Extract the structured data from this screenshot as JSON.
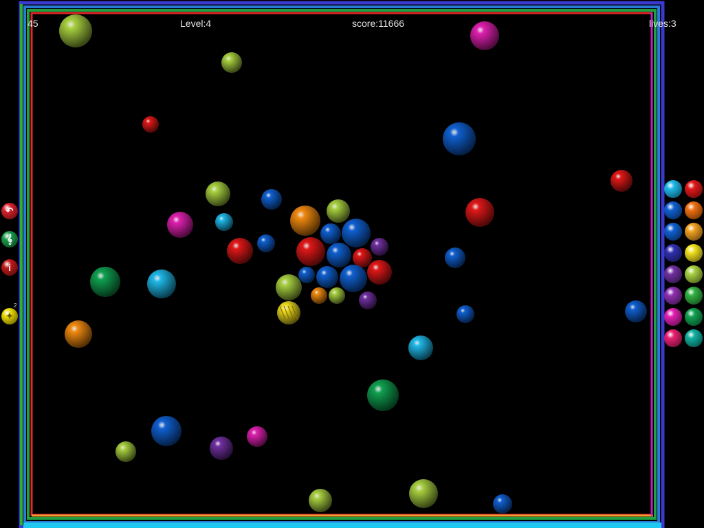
{
  "hud": {
    "timer": "45",
    "level": "Level:4",
    "score": "score:11666",
    "lives": "lives:3"
  },
  "side_controls": [
    {
      "name": "back-button",
      "icon": "back-arrow-icon",
      "color": "#d8202a"
    },
    {
      "name": "music-button",
      "icon": "treble-clef-icon",
      "color": "#1a9a4a"
    },
    {
      "name": "info-button",
      "icon": "info-icon",
      "color": "#c01818"
    },
    {
      "name": "life-powerup-button",
      "icon": "life-ball-icon",
      "color": "#e8d800",
      "count": "2"
    }
  ],
  "palette": [
    {
      "color": "#1fb8e8",
      "count": ""
    },
    {
      "color": "#e01818",
      "count": ""
    },
    {
      "color": "#1060d0",
      "count": ""
    },
    {
      "color": "#f07010",
      "count": ""
    },
    {
      "color": "#1060d0",
      "count": ""
    },
    {
      "color": "#f0a020",
      "count": ""
    },
    {
      "color": "#3030b0",
      "count": ""
    },
    {
      "color": "#f0e020",
      "count": ""
    },
    {
      "color": "#7030a0",
      "count": ""
    },
    {
      "color": "#a8d040",
      "count": ""
    },
    {
      "color": "#9030b0",
      "count": ""
    },
    {
      "color": "#30b040",
      "count": ""
    },
    {
      "color": "#e020b0",
      "count": ""
    },
    {
      "color": "#10a050",
      "count": ""
    },
    {
      "color": "#e82070",
      "count": ""
    },
    {
      "color": "#10b0a0",
      "count": ""
    }
  ],
  "colors": {
    "red": "#e01818",
    "blue": "#1060d0",
    "cyan": "#1fb8e8",
    "lime": "#a8d040",
    "magenta": "#e020b0",
    "orange": "#f08a10",
    "green": "#10a050",
    "purple": "#7030a0",
    "yellow": "#f0e020"
  }
}
